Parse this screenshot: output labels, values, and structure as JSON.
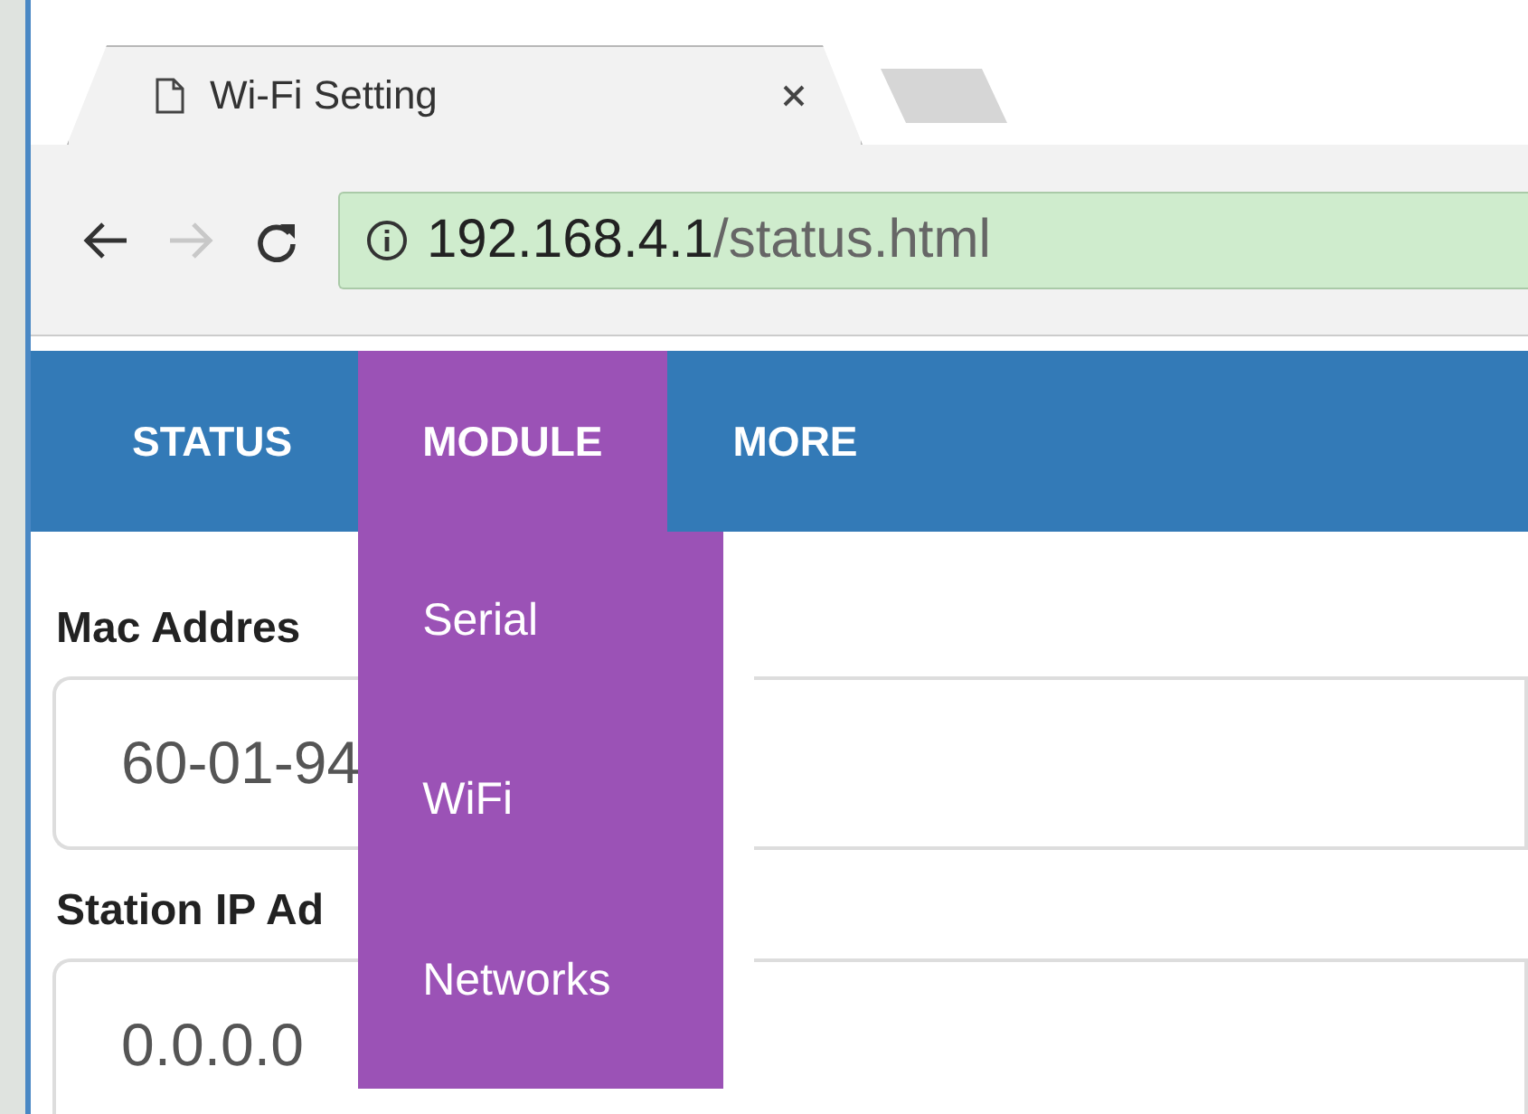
{
  "browser": {
    "tab_title": "Wi-Fi Setting",
    "url_host": "192.168.4.1",
    "url_path": "/status.html",
    "forward_disabled": true
  },
  "nav": [
    {
      "label": "STATUS",
      "selected": false
    },
    {
      "label": "MODULE",
      "selected": true,
      "expanded": true,
      "menu": [
        {
          "label": "Serial"
        },
        {
          "label": "WiFi"
        },
        {
          "label": "Networks"
        }
      ]
    },
    {
      "label": "MORE",
      "selected": false
    }
  ],
  "fields": [
    {
      "label": "Mac Addres",
      "value": "60-01-94"
    },
    {
      "label": "Station IP Ad",
      "value": "0.0.0.0"
    }
  ]
}
